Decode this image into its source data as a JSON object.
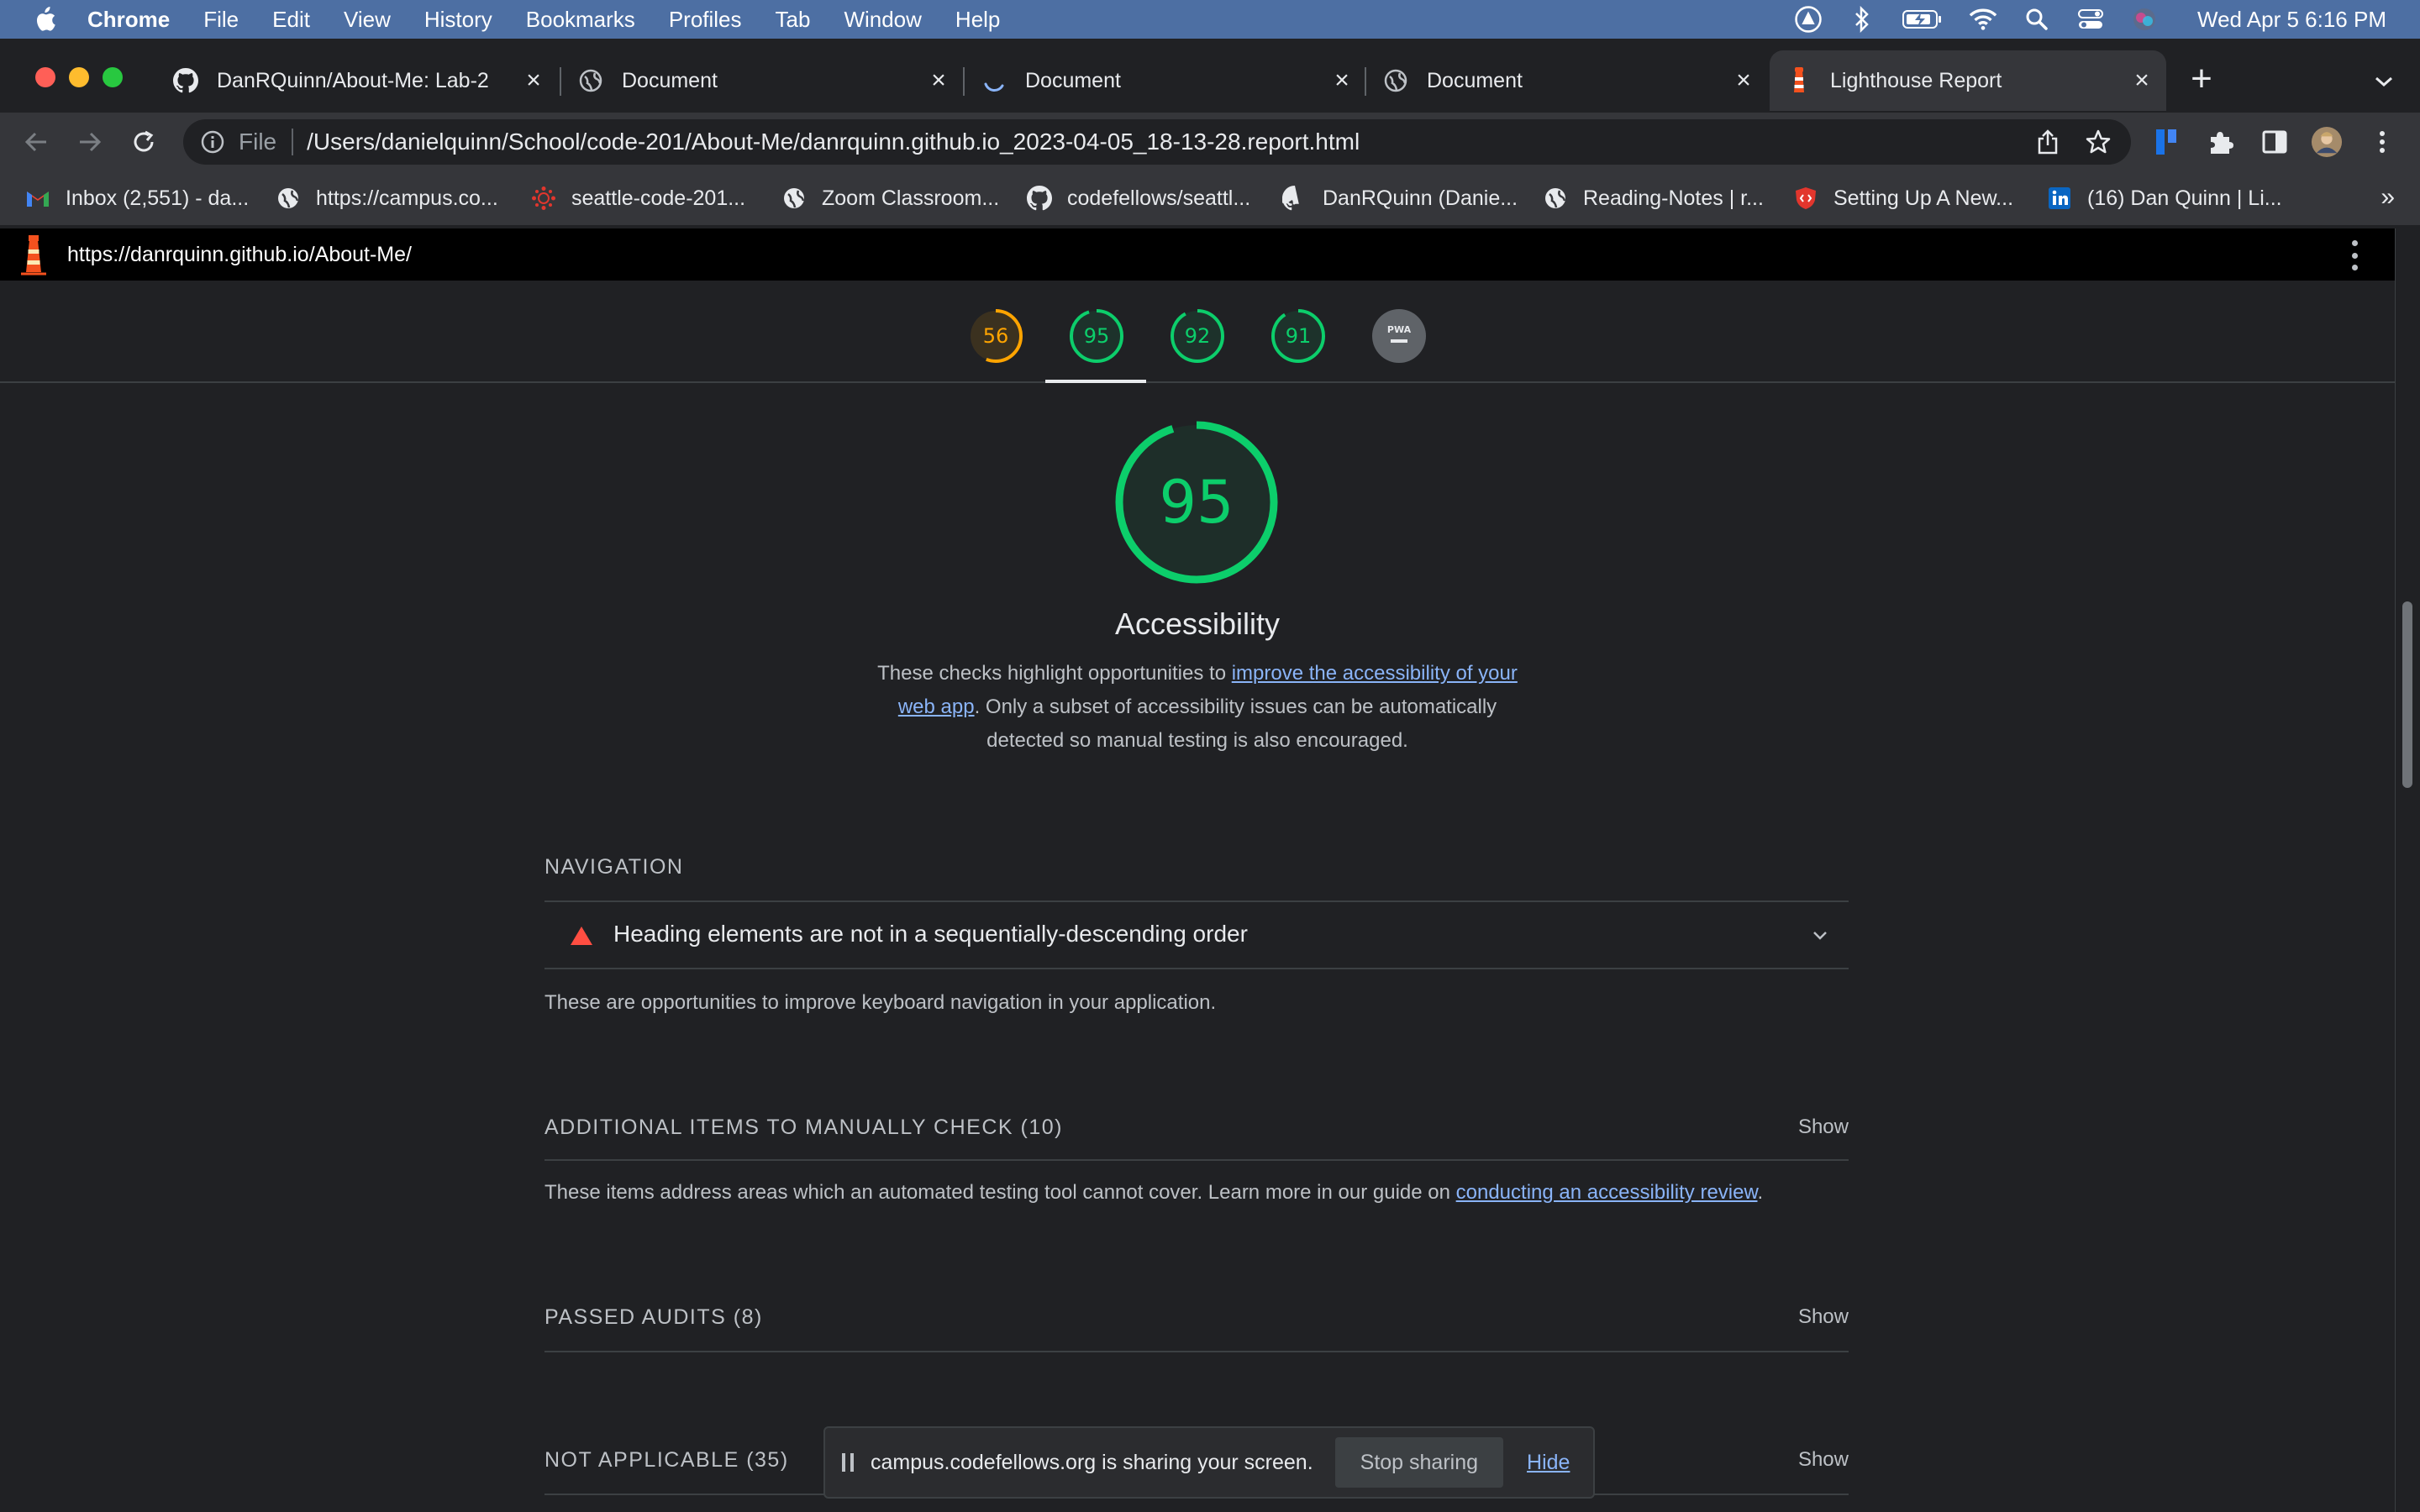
{
  "menubar": {
    "app": "Chrome",
    "items": [
      "File",
      "Edit",
      "View",
      "History",
      "Bookmarks",
      "Profiles",
      "Tab",
      "Window",
      "Help"
    ],
    "clock": "Wed Apr 5  6:16 PM"
  },
  "tabs": [
    {
      "title": "DanRQuinn/About-Me: Lab-2",
      "icon": "github-icon"
    },
    {
      "title": "Document",
      "icon": "globe-icon"
    },
    {
      "title": "Document",
      "icon": "loading-spinner-icon"
    },
    {
      "title": "Document",
      "icon": "globe-icon"
    },
    {
      "title": "Lighthouse Report",
      "icon": "lighthouse-icon",
      "active": true
    }
  ],
  "omnibox": {
    "scheme": "File",
    "url": "/Users/danielquinn/School/code-201/About-Me/danrquinn.github.io_2023-04-05_18-13-28.report.html"
  },
  "bookmarks": [
    {
      "label": "Inbox (2,551) - da...",
      "icon": "gmail-icon"
    },
    {
      "label": "https://campus.co...",
      "icon": "globe-icon"
    },
    {
      "label": "seattle-code-201...",
      "icon": "canvas-icon"
    },
    {
      "label": "Zoom Classroom...",
      "icon": "globe-icon"
    },
    {
      "label": "codefellows/seattl...",
      "icon": "github-icon"
    },
    {
      "label": "DanRQuinn (Danie...",
      "icon": "github-icon"
    },
    {
      "label": "Reading-Notes | r...",
      "icon": "globe-icon"
    },
    {
      "label": "Setting Up A New...",
      "icon": "shield-code-icon"
    },
    {
      "label": "(16) Dan Quinn | Li...",
      "icon": "linkedin-icon"
    }
  ],
  "report": {
    "url": "https://danrquinn.github.io/About-Me/",
    "scores": [
      56,
      95,
      92,
      91
    ],
    "pwa_label": "PWA",
    "main_score": 95,
    "category_title": "Accessibility",
    "desc_prefix": "These checks highlight opportunities to ",
    "desc_link": "improve the accessibility of your web app",
    "desc_suffix": ". Only a subset of accessibility issues can be automatically detected so manual testing is also encouraged.",
    "navigation": {
      "title": "NAVIGATION",
      "audit": "Heading elements are not in a sequentially-descending order",
      "note": "These are opportunities to improve keyboard navigation in your application."
    },
    "manual": {
      "title": "ADDITIONAL ITEMS TO MANUALLY CHECK (10)",
      "show": "Show",
      "note_prefix": "These items address areas which an automated testing tool cannot cover. Learn more in our guide on ",
      "note_link": "conducting an accessibility review",
      "note_suffix": "."
    },
    "passed": {
      "title": "PASSED AUDITS (8)",
      "show": "Show"
    },
    "not_applicable": {
      "title": "NOT APPLICABLE (35)",
      "show": "Show"
    }
  },
  "share_bar": {
    "message": "campus.codefellows.org is sharing your screen.",
    "stop": "Stop sharing",
    "hide": "Hide"
  },
  "colors": {
    "pass": "#0cce6b",
    "average": "#ffa400",
    "fail": "#ff4e42",
    "link": "#8ab4f8",
    "menubar": "#4d6fa3"
  }
}
